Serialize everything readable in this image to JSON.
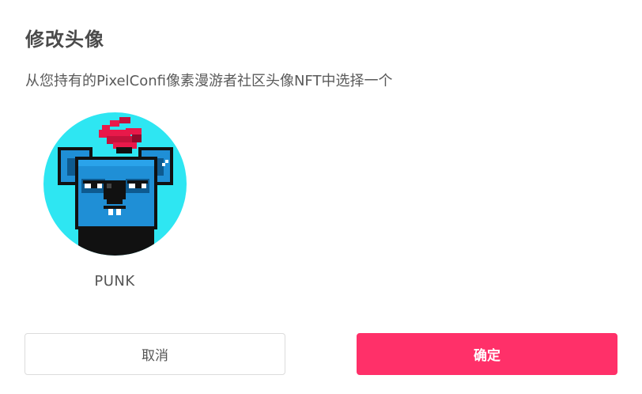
{
  "dialog": {
    "title": "修改头像",
    "subtitle": "从您持有的PixelConfi像素漫游者社区头像NFT中选择一个"
  },
  "nfts": [
    {
      "name": "PUNK",
      "image": "pixel-art blue koala avatar with red mohawk on cyan background"
    }
  ],
  "buttons": {
    "cancel_label": "取消",
    "confirm_label": "确定"
  },
  "colors": {
    "accent": "#ff3069",
    "avatar_background": "#2ee6f2",
    "koala_body": "#1f8fd6",
    "mohawk": "#e8194a"
  }
}
